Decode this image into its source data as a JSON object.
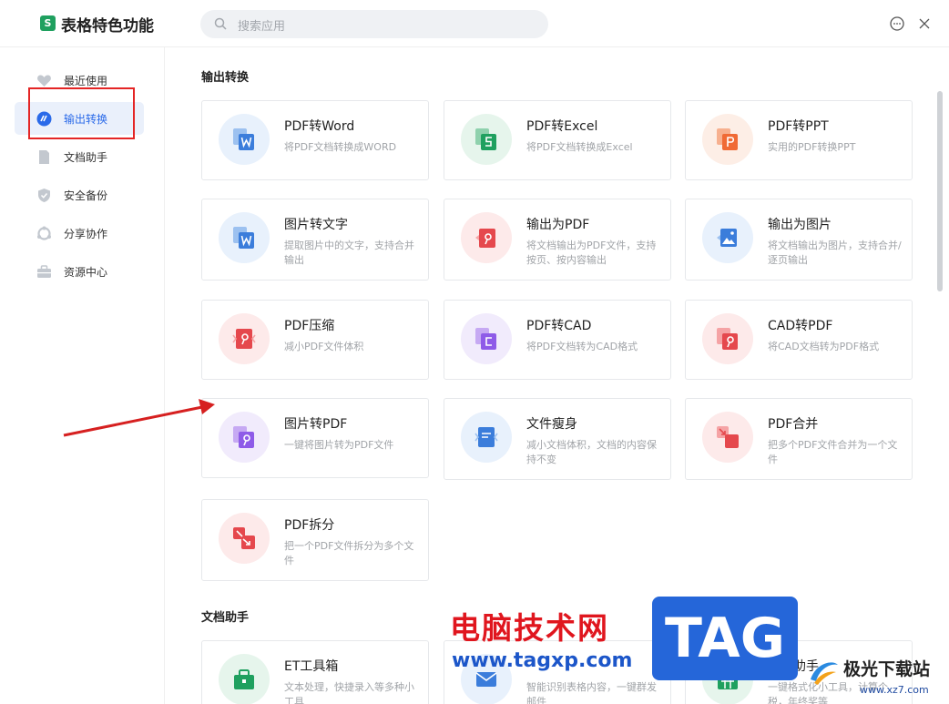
{
  "app": {
    "title": "表格特色功能",
    "logo_letter": "S"
  },
  "search": {
    "placeholder": "搜索应用"
  },
  "sidebar": {
    "items": [
      {
        "label": "最近使用",
        "icon": "heart-icon"
      },
      {
        "label": "输出转换",
        "icon": "convert-icon",
        "active": true
      },
      {
        "label": "文档助手",
        "icon": "document-icon"
      },
      {
        "label": "安全备份",
        "icon": "shield-icon"
      },
      {
        "label": "分享协作",
        "icon": "share-icon"
      },
      {
        "label": "资源中心",
        "icon": "briefcase-icon"
      }
    ]
  },
  "sections": [
    {
      "title": "输出转换",
      "cards": [
        {
          "title": "PDF转Word",
          "desc": "将PDF文档转换成WORD",
          "icon": "pdf-to-word-icon",
          "color": "#3b7ddb"
        },
        {
          "title": "PDF转Excel",
          "desc": "将PDF文档转换成Excel",
          "icon": "pdf-to-excel-icon",
          "color": "#1fa05f"
        },
        {
          "title": "PDF转PPT",
          "desc": "实用的PDF转换PPT",
          "icon": "pdf-to-ppt-icon",
          "color": "#f06a35"
        },
        {
          "title": "图片转文字",
          "desc": "提取图片中的文字，支持合并输出",
          "icon": "image-to-text-icon",
          "color": "#3b7ddb"
        },
        {
          "title": "输出为PDF",
          "desc": "将文档输出为PDF文件，支持按页、按内容输出",
          "icon": "export-pdf-icon",
          "color": "#e5484d"
        },
        {
          "title": "输出为图片",
          "desc": "将文档输出为图片，支持合并/逐页输出",
          "icon": "export-image-icon",
          "color": "#3b7ddb"
        },
        {
          "title": "PDF压缩",
          "desc": "减小PDF文件体积",
          "icon": "pdf-compress-icon",
          "color": "#e5484d"
        },
        {
          "title": "PDF转CAD",
          "desc": "将PDF文档转为CAD格式",
          "icon": "pdf-to-cad-icon",
          "color": "#8e5be8"
        },
        {
          "title": "CAD转PDF",
          "desc": "将CAD文档转为PDF格式",
          "icon": "cad-to-pdf-icon",
          "color": "#e5484d"
        },
        {
          "title": "图片转PDF",
          "desc": "一键将图片转为PDF文件",
          "icon": "image-to-pdf-icon",
          "color": "#8e5be8"
        },
        {
          "title": "文件瘦身",
          "desc": "减小文档体积，文档的内容保持不变",
          "icon": "file-slim-icon",
          "color": "#3b7ddb"
        },
        {
          "title": "PDF合并",
          "desc": "把多个PDF文件合并为一个文件",
          "icon": "pdf-merge-icon",
          "color": "#e5484d"
        },
        {
          "title": "PDF拆分",
          "desc": "把一个PDF文件拆分为多个文件",
          "icon": "pdf-split-icon",
          "color": "#e5484d"
        }
      ]
    },
    {
      "title": "文档助手",
      "cards": [
        {
          "title": "ET工具箱",
          "desc": "文本处理，快捷录入等多种小工具",
          "icon": "toolbox-icon",
          "color": "#1fa05f"
        },
        {
          "title": "",
          "desc": "智能识别表格内容，一键群发邮件",
          "icon": "mail-merge-icon",
          "color": "#3b7ddb"
        },
        {
          "title": "财务助手",
          "desc": "一键格式化小工具，计算个税，年终奖等",
          "icon": "finance-icon",
          "color": "#1fa05f"
        }
      ]
    }
  ],
  "watermark": {
    "cn_text": "电脑技术网",
    "url": "www.tagxp.com",
    "tag": "TAG",
    "site_name": "极光下载站",
    "site_url": "www.xz7.com"
  }
}
